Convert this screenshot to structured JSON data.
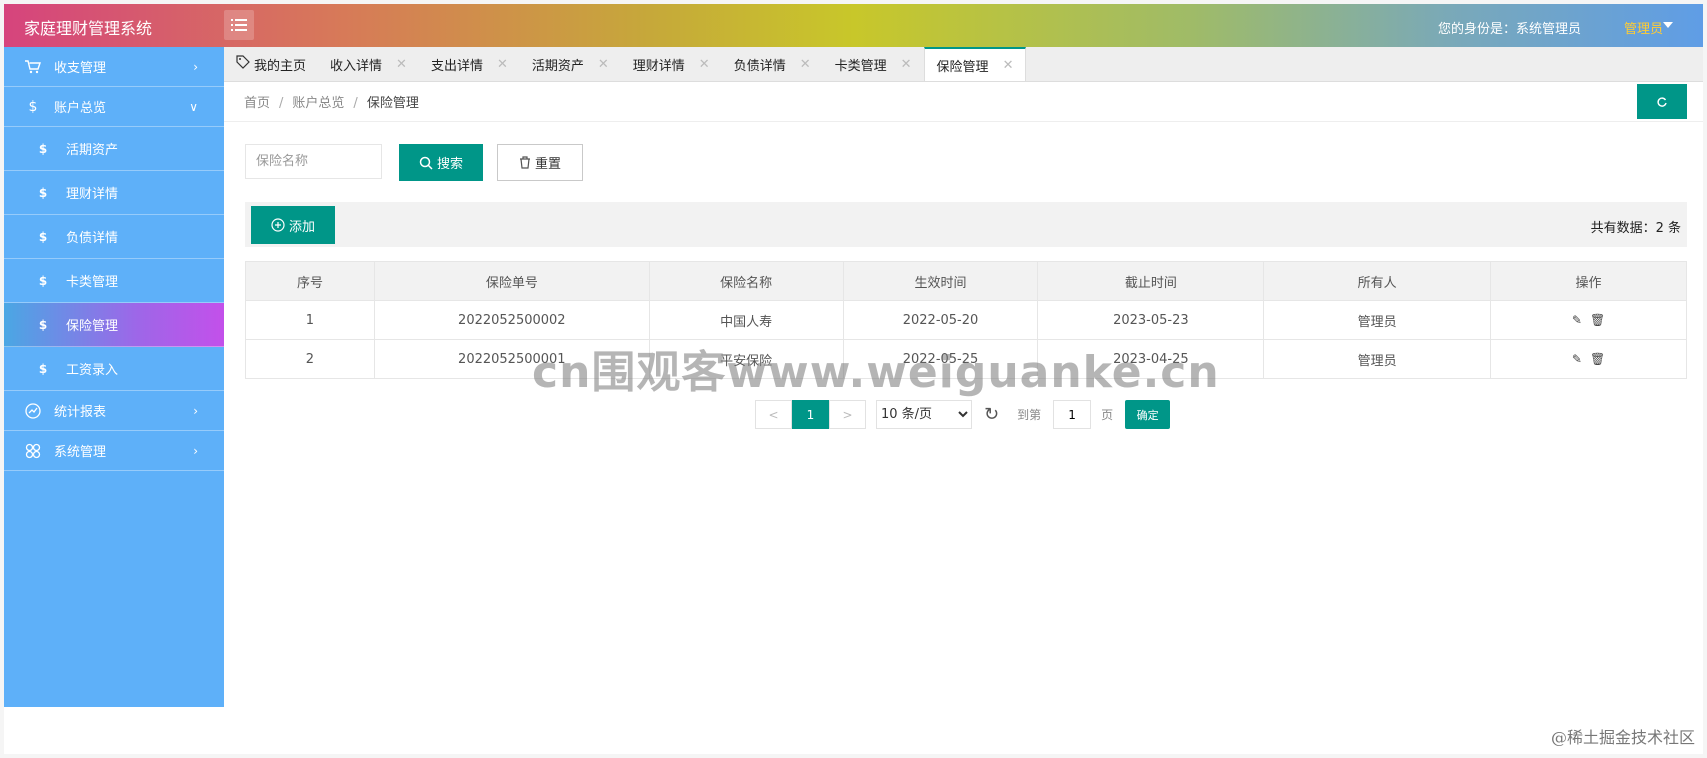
{
  "header": {
    "title": "家庭理财管理系统",
    "identity_text": "您的身份是：系统管理员",
    "user_menu_label": "管理员"
  },
  "sidebar": {
    "items": [
      {
        "label": "收支管理",
        "icon": "cart-icon",
        "type": "top",
        "arrow": ">"
      },
      {
        "label": "账户总览",
        "icon": "dollar-icon",
        "type": "top",
        "arrow": "v"
      },
      {
        "label": "活期资产",
        "icon": "dollar-icon",
        "type": "sub"
      },
      {
        "label": "理财详情",
        "icon": "dollar-icon",
        "type": "sub"
      },
      {
        "label": "负债详情",
        "icon": "dollar-icon",
        "type": "sub"
      },
      {
        "label": "卡类管理",
        "icon": "dollar-icon",
        "type": "sub"
      },
      {
        "label": "保险管理",
        "icon": "dollar-icon",
        "type": "sub",
        "active": true
      },
      {
        "label": "工资录入",
        "icon": "dollar-icon",
        "type": "sub"
      },
      {
        "label": "统计报表",
        "icon": "chart-icon",
        "type": "top",
        "arrow": ">"
      },
      {
        "label": "系统管理",
        "icon": "grid-icon",
        "type": "top",
        "arrow": ">"
      }
    ]
  },
  "tabs": [
    {
      "label": "我的主页"
    },
    {
      "label": "收入详情"
    },
    {
      "label": "支出详情"
    },
    {
      "label": "活期资产"
    },
    {
      "label": "理财详情"
    },
    {
      "label": "负债详情"
    },
    {
      "label": "卡类管理"
    },
    {
      "label": "保险管理",
      "active": true
    }
  ],
  "breadcrumb": {
    "items": [
      "首页",
      "账户总览",
      "保险管理"
    ],
    "separator": "/"
  },
  "search": {
    "placeholder": "保险名称",
    "value": "",
    "search_label": "搜索",
    "reset_label": "重置"
  },
  "toolbar": {
    "add_label": "添加",
    "total_text": "共有数据：2 条"
  },
  "table": {
    "columns": [
      "序号",
      "保险单号",
      "保险名称",
      "生效时间",
      "截止时间",
      "所有人",
      "操作"
    ],
    "rows": [
      [
        "1",
        "2022052500002",
        "中国人寿",
        "2022-05-20",
        "2023-05-23",
        "管理员"
      ],
      [
        "2",
        "2022052500001",
        "平安保险",
        "2022-05-25",
        "2023-04-25",
        "管理员"
      ]
    ]
  },
  "pagination": {
    "prev": "<",
    "current_page": "1",
    "next": ">",
    "page_size": "10 条/页",
    "page_size_options": [
      "10 条/页"
    ],
    "goto_label": "到第",
    "goto_value": "1",
    "page_label": "页",
    "confirm_label": "确定"
  },
  "watermark": "cn围观客www.weiguanke.cn",
  "corner_watermark": "@稀土掘金技术社区",
  "colors": {
    "primary": "#009688",
    "sidebar_bg": "#5eb0f9",
    "admin_name": "#ffcc33"
  }
}
